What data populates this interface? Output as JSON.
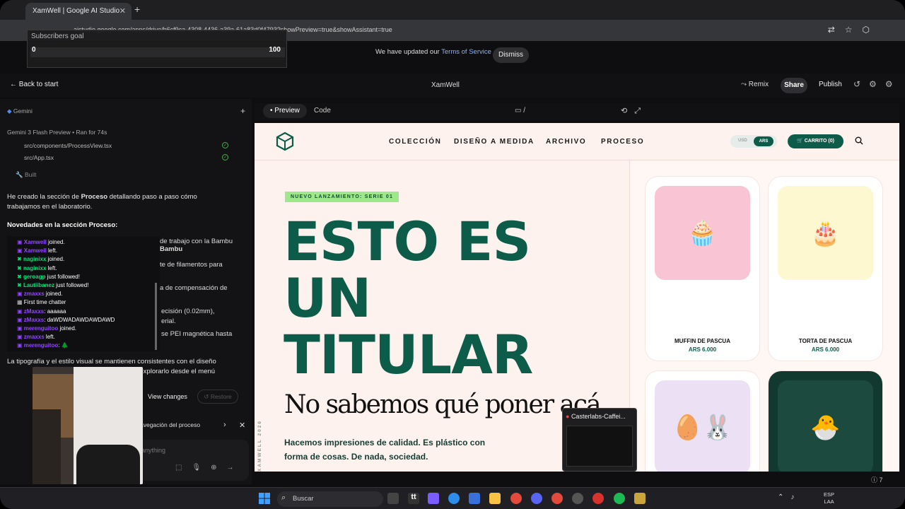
{
  "browser": {
    "tab_title": "XamWell | Google AI Studio",
    "url": "aistudio.google.com/apps/drive/b6cf9ca-4308-4436-a39a-61a83d0f4793?showPreview=true&showAssistant=true"
  },
  "goal": {
    "title": "Subscribers goal",
    "min": "0",
    "max": "100",
    "progress": 0.0
  },
  "notice": {
    "text": "We have updated our ",
    "link": "Terms of Service",
    "dismiss": "Dismiss"
  },
  "header": {
    "back": "Back to start",
    "title": "XamWell",
    "remix": "Remix",
    "share": "Share",
    "publish": "Publish"
  },
  "assistant": {
    "model_label": "Gemini",
    "run_info": "Gemini 3 Flash Preview  •  Ran for 74s",
    "files": [
      "src/components/ProcessView.tsx",
      "src/App.tsx"
    ],
    "built": "Built",
    "intro_line1": "He creado la sección de ",
    "intro_bold": "Proceso",
    "intro_line1_tail": " detallando paso a paso cómo",
    "intro_line2": "trabajamos en el laboratorio.",
    "novedades": "Novedades en la sección Proceso:",
    "fragments": [
      "de trabajo con la Bambu",
      "te de filamentos para",
      "a de compensación de",
      "ecisión (0.02mm),",
      "erial.",
      "se PEI magnética hasta"
    ],
    "closing_line1": "La tipografía y el estilo visual se mantienen consistentes con el diseño",
    "closing_line2": "s explorarlo desde el menú",
    "view_changes": "View changes",
    "restore": "Restore",
    "suggestion": "avegación del proceso",
    "input_placeholder": "anything"
  },
  "chat": [
    {
      "user": "Xamwell",
      "text": " joined.",
      "color": "purple"
    },
    {
      "user": "Xamwell",
      "text": " left.",
      "color": "purple"
    },
    {
      "user": "naginixx",
      "text": " joined.",
      "color": "green"
    },
    {
      "user": "naginixx",
      "text": " left.",
      "color": "green"
    },
    {
      "user": "geroagp",
      "text": " just followed!",
      "color": "green"
    },
    {
      "user": "Lautiibanez",
      "text": " just followed!",
      "color": "green"
    },
    {
      "user": "zmaxxs",
      "text": " joined.",
      "color": "purple"
    },
    {
      "user": "",
      "text": "First time chatter",
      "color": "white"
    },
    {
      "user": "zMaxxs",
      "text": ": aaaaaa",
      "color": "purple"
    },
    {
      "user": "zMaxxs",
      "text": ": daWDWADAWDAWDAWD",
      "color": "purple"
    },
    {
      "user": "merenguitoo",
      "text": " joined.",
      "color": "purple"
    },
    {
      "user": "zmaxxs",
      "text": " left.",
      "color": "purple"
    },
    {
      "user": "merenguitoo",
      "text": ": 🌲",
      "color": "purple"
    }
  ],
  "preview": {
    "tab_preview": "Preview",
    "tab_code": "Code",
    "path": "/"
  },
  "site": {
    "nav": [
      "COLECCIÓN",
      "DISEÑO A MEDIDA",
      "ARCHIVO",
      "PROCESO"
    ],
    "currency_usd": "USD",
    "currency_ars": "ARS",
    "cart": "CARRITO (0)",
    "badge": "NUEVO LANZAMIENTO: SERIE 01",
    "hero": [
      "ESTO ES",
      "UN",
      "TITULAR"
    ],
    "subtitle": "No sabemos qué poner acá.",
    "desc": "Hacemos impresiones de calidad. Es plástico con forma de cosas. De nada, sociedad.",
    "vertical": "XAMWELL 2026",
    "products": [
      {
        "name": "MUFFIN DE PASCUA",
        "price": "ARS 6.000",
        "bg": "#f9c5d5",
        "emoji": "🧁"
      },
      {
        "name": "TORTA DE PASCUA",
        "price": "ARS 6.000",
        "bg": "#fdf8cf",
        "emoji": "🎂"
      },
      {
        "name": "",
        "price": "",
        "bg": "#ebe0f4",
        "emoji": "🥚🐰"
      },
      {
        "name": "",
        "price": "",
        "bg": "#1c4a3f",
        "emoji": "🐣"
      }
    ]
  },
  "caster": {
    "title": "Casterlabs-Caffei..."
  },
  "bottom_info": "ⓘ 7",
  "taskbar": {
    "search": "Buscar",
    "lang1": "ESP",
    "lang2": "LAA"
  },
  "colors": {
    "brand": "#0d5c4a",
    "badge": "#9de88a",
    "accent_link": "#8ab4f8"
  }
}
